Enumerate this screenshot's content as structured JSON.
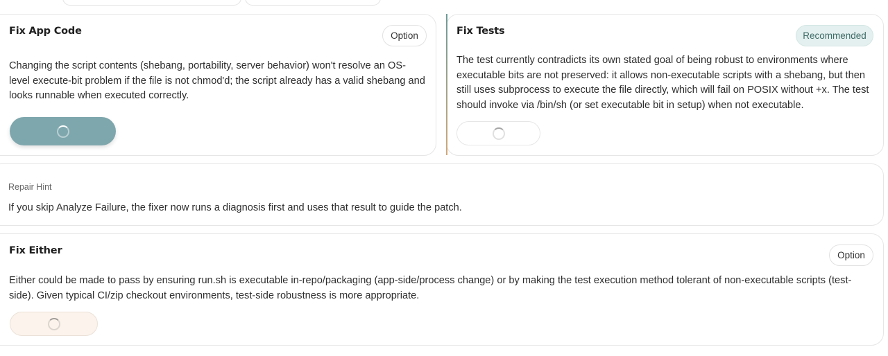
{
  "cards": {
    "app": {
      "title": "Fix App Code",
      "badge": "Option",
      "body": "Changing the script contents (shebang, portability, server behavior) won't resolve an OS-level execute-bit problem if the file is not chmod'd; the script already has a valid shebang and looks runnable when executed correctly.",
      "button_state": "loading",
      "accent_color": "#7ea7ad"
    },
    "tests": {
      "title": "Fix Tests",
      "badge": "Recommended",
      "body": "The test currently contradicts its own stated goal of being robust to environments where executable bits are not preserved: it allows non-executable scripts with a shebang, but then still uses subprocess to execute the file directly, which will fail on POSIX without +x. The test should invoke via /bin/sh (or set executable bit in setup) when not executable.",
      "button_state": "loading"
    },
    "either": {
      "title": "Fix Either",
      "badge": "Option",
      "body": "Either could be made to pass by ensuring run.sh is executable in-repo/packaging (app-side/process change) or by making the test execution method tolerant of non-executable scripts (test-side). Given typical CI/zip checkout environments, test-side robustness is more appropriate.",
      "button_state": "loading"
    }
  },
  "hint": {
    "label": "Repair Hint",
    "text": "If you skip Analyze Failure, the fixer now runs a diagnosis first and uses that result to guide the patch."
  }
}
